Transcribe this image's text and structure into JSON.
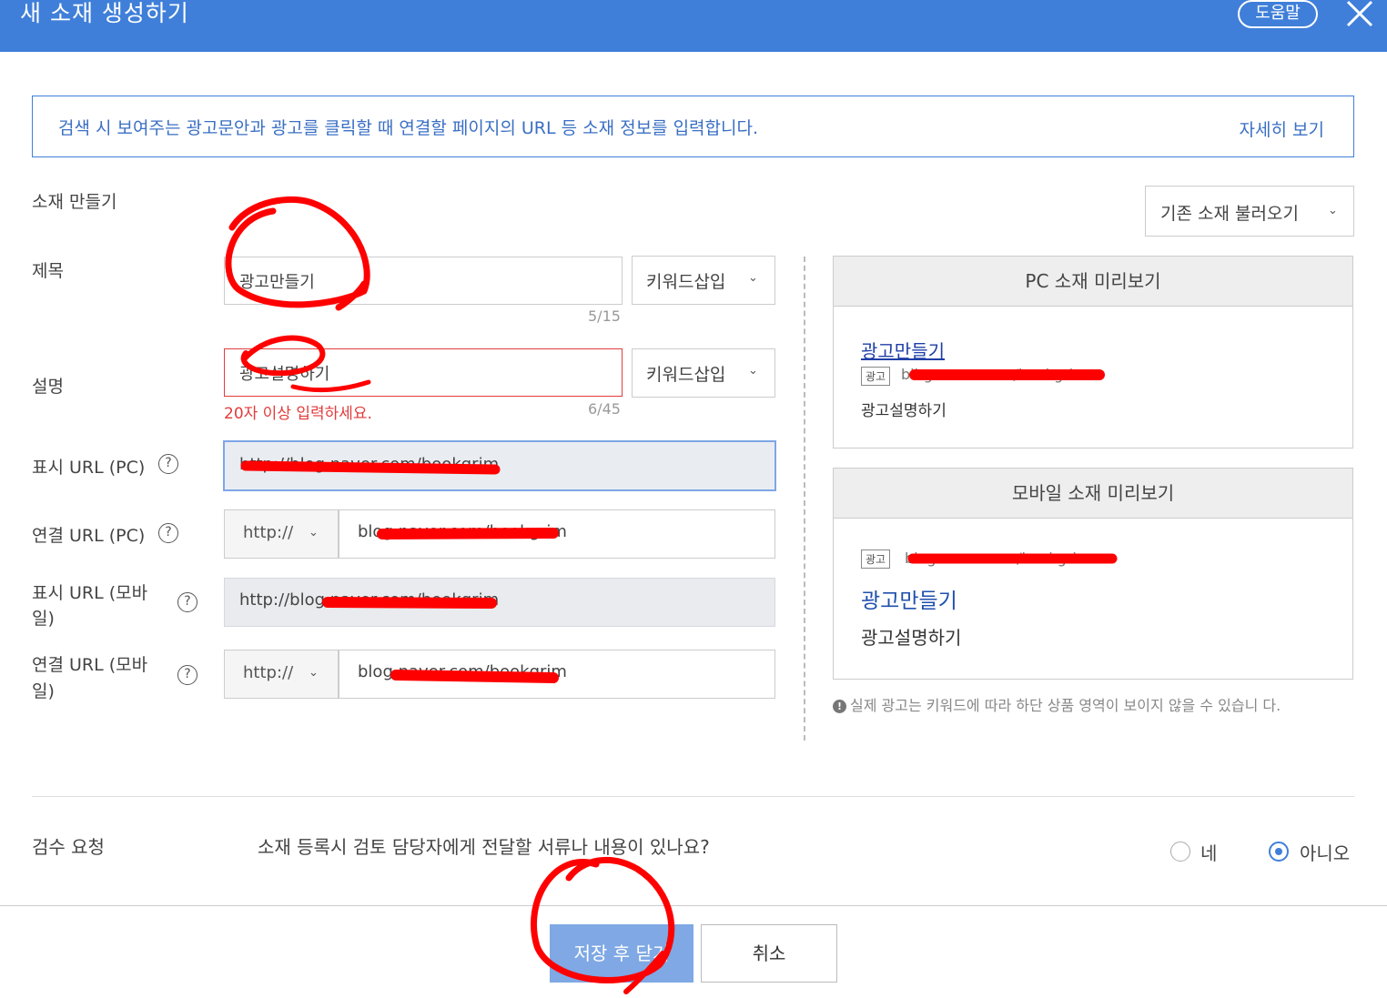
{
  "header": {
    "title": "새 소재 생성하기",
    "help_label": "도움말"
  },
  "info": {
    "message": "검색 시 보여주는 광고문안과 광고를 클릭할 때 연결할 페이지의 URL 등 소재 정보를 입력합니다.",
    "more_link": "자세히 보기"
  },
  "section_title": "소재 만들기",
  "load_existing_label": "기존 소재 불러오기",
  "form": {
    "title_label": "제목",
    "title_value": "광고만들기",
    "title_counter": "5/15",
    "desc_label": "설명",
    "desc_value": "광고설명하기",
    "desc_error": "20자 이상 입력하세요.",
    "desc_counter": "6/45",
    "keyword_insert_label": "키워드삽입",
    "display_url_pc_label": "표시 URL (PC)",
    "display_url_pc_value": "http://blog.naver.com/bookgrim",
    "link_url_pc_label": "연결 URL (PC)",
    "link_url_pc_protocol": "http://",
    "link_url_pc_value": "blog.naver.com/bookgrim",
    "display_url_mobile_label_1": "표시 URL (모바",
    "display_url_mobile_label_2": "일)",
    "display_url_mobile_value": "http://blog.naver.com/bookgrim",
    "link_url_mobile_label_1": "연결 URL (모바",
    "link_url_mobile_label_2": "일)",
    "link_url_mobile_protocol": "http://",
    "link_url_mobile_value": "blog.naver.com/bookgrim",
    "help_glyph": "?"
  },
  "preview_pc": {
    "header": "PC 소재 미리보기",
    "title": "광고만들기",
    "badge": "광고",
    "url": "blbg.naver.com/bookgrim",
    "desc": "광고설명하기"
  },
  "preview_mobile": {
    "header": "모바일 소재 미리보기",
    "badge": "광고",
    "url": "blog.naver.com/bookgrim",
    "title": "광고만들기",
    "desc": "광고설명하기"
  },
  "note": {
    "icon": "!",
    "text": "실제 광고는 키워드에 따라 하단 상품 영역이 보이지 않을 수 있습니 다."
  },
  "review": {
    "label": "검수 요청",
    "question": "소재 등록시 검토 담당자에게 전달할 서류나 내용이 있나요?",
    "yes_label": "네",
    "no_label": "아니오",
    "selected": "아니오"
  },
  "footer": {
    "save_label": "저장 후 닫기",
    "cancel_label": "취소"
  },
  "colors": {
    "header_bg": "#3f7fd9",
    "error": "#e23b3b",
    "link": "#1f3ea6",
    "annotation": "#ff0000"
  },
  "icons": [
    "close-icon",
    "chevron-down-icon",
    "help-icon",
    "info-icon",
    "radio-icon"
  ]
}
